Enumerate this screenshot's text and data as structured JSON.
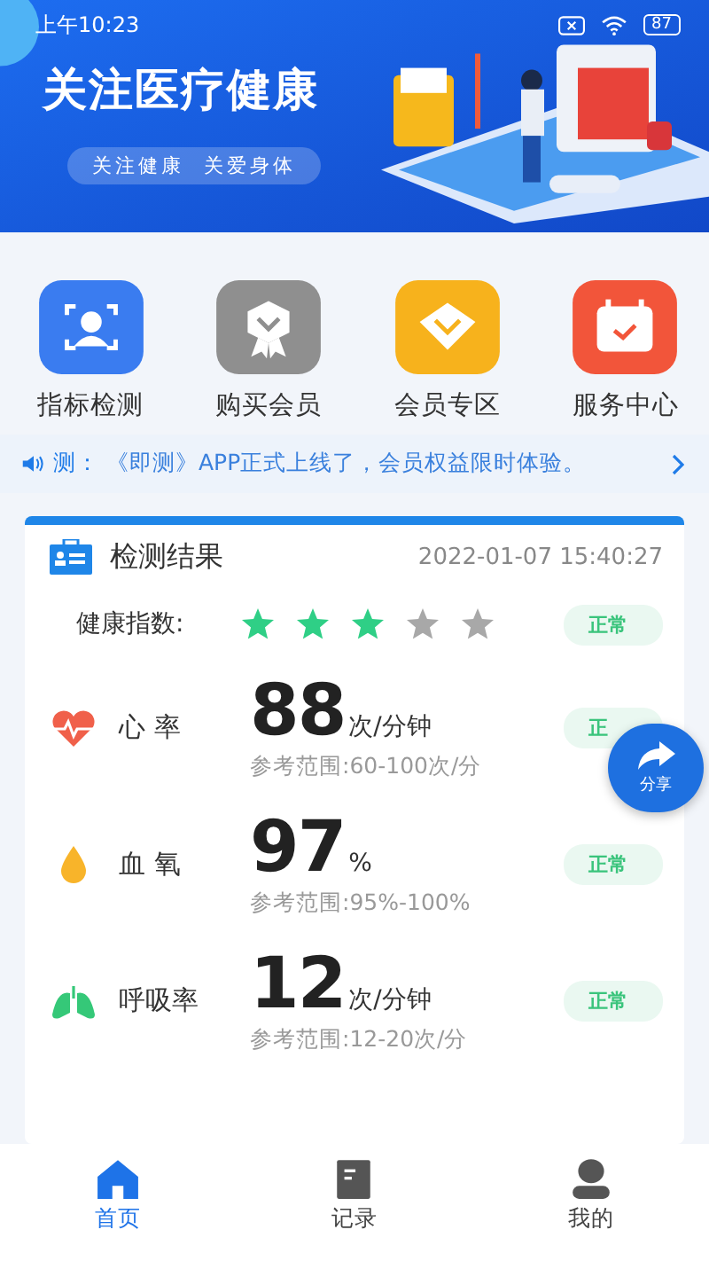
{
  "status_bar": {
    "time": "上午10:23",
    "battery": "87"
  },
  "banner": {
    "title": "关注医疗健康",
    "subtitle": "关注健康  关爱身体"
  },
  "shortcuts": [
    {
      "label": "指标检测",
      "kind": "scan",
      "color": "#3a7cf0"
    },
    {
      "label": "购买会员",
      "kind": "badge",
      "color": "#8f8f8f"
    },
    {
      "label": "会员专区",
      "kind": "diamond",
      "color": "#f7b21c"
    },
    {
      "label": "服务中心",
      "kind": "calendar",
      "color": "#f2553a"
    }
  ],
  "notice": {
    "prefix": "测：",
    "text": "《即测》APP正式上线了，会员权益限时体验。"
  },
  "results": {
    "title": "检测结果",
    "time": "2022-01-07 15:40:27",
    "health_index": {
      "label": "健康指数:",
      "stars": 3,
      "status": "正常"
    },
    "metrics": [
      {
        "kind": "heart",
        "name": "心 率",
        "value": "88",
        "unit": "次/分钟",
        "range": "参考范围:60-100次/分",
        "status": "正"
      },
      {
        "kind": "drop",
        "name": "血 氧",
        "value": "97",
        "unit": "%",
        "range": "参考范围:95%-100%",
        "status": "正常"
      },
      {
        "kind": "lungs",
        "name": "呼吸率",
        "value": "12",
        "unit": "次/分钟",
        "range": "参考范围:12-20次/分",
        "status": "正常"
      }
    ]
  },
  "share_button": {
    "label": "分享"
  },
  "tab_bar": [
    {
      "label": "首页",
      "kind": "home",
      "selected": true
    },
    {
      "label": "记录",
      "kind": "notebook",
      "selected": false
    },
    {
      "label": "我的",
      "kind": "person",
      "selected": false
    }
  ]
}
